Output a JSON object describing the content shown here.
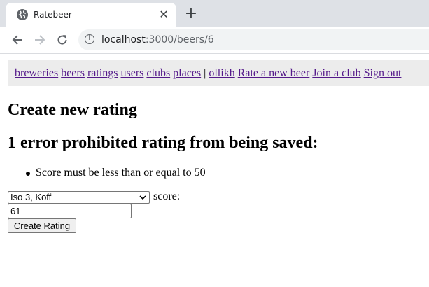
{
  "browser": {
    "tab_title": "Ratebeer",
    "close_glyph": "✕",
    "newtab_glyph": "+",
    "url_host": "localhost",
    "url_path": ":3000/beers/6"
  },
  "nav": {
    "links": [
      "breweries",
      "beers",
      "ratings",
      "users",
      "clubs",
      "places"
    ],
    "separator": "|",
    "user": "ollikh",
    "rate_beer": "Rate a new beer",
    "join_club": "Join a club",
    "sign_out": "Sign out"
  },
  "main": {
    "title": "Create new rating",
    "error_heading": "1 error prohibited rating from being saved:",
    "errors": [
      "Score must be less than or equal to 50"
    ],
    "beer_select_value": "Iso 3, Koff",
    "score_label": "score:",
    "score_value": "61",
    "submit_label": "Create Rating"
  },
  "colors": {
    "link": "#551a8b",
    "navbar_bg": "#ececec",
    "tabstrip_bg": "#dee1e6"
  }
}
